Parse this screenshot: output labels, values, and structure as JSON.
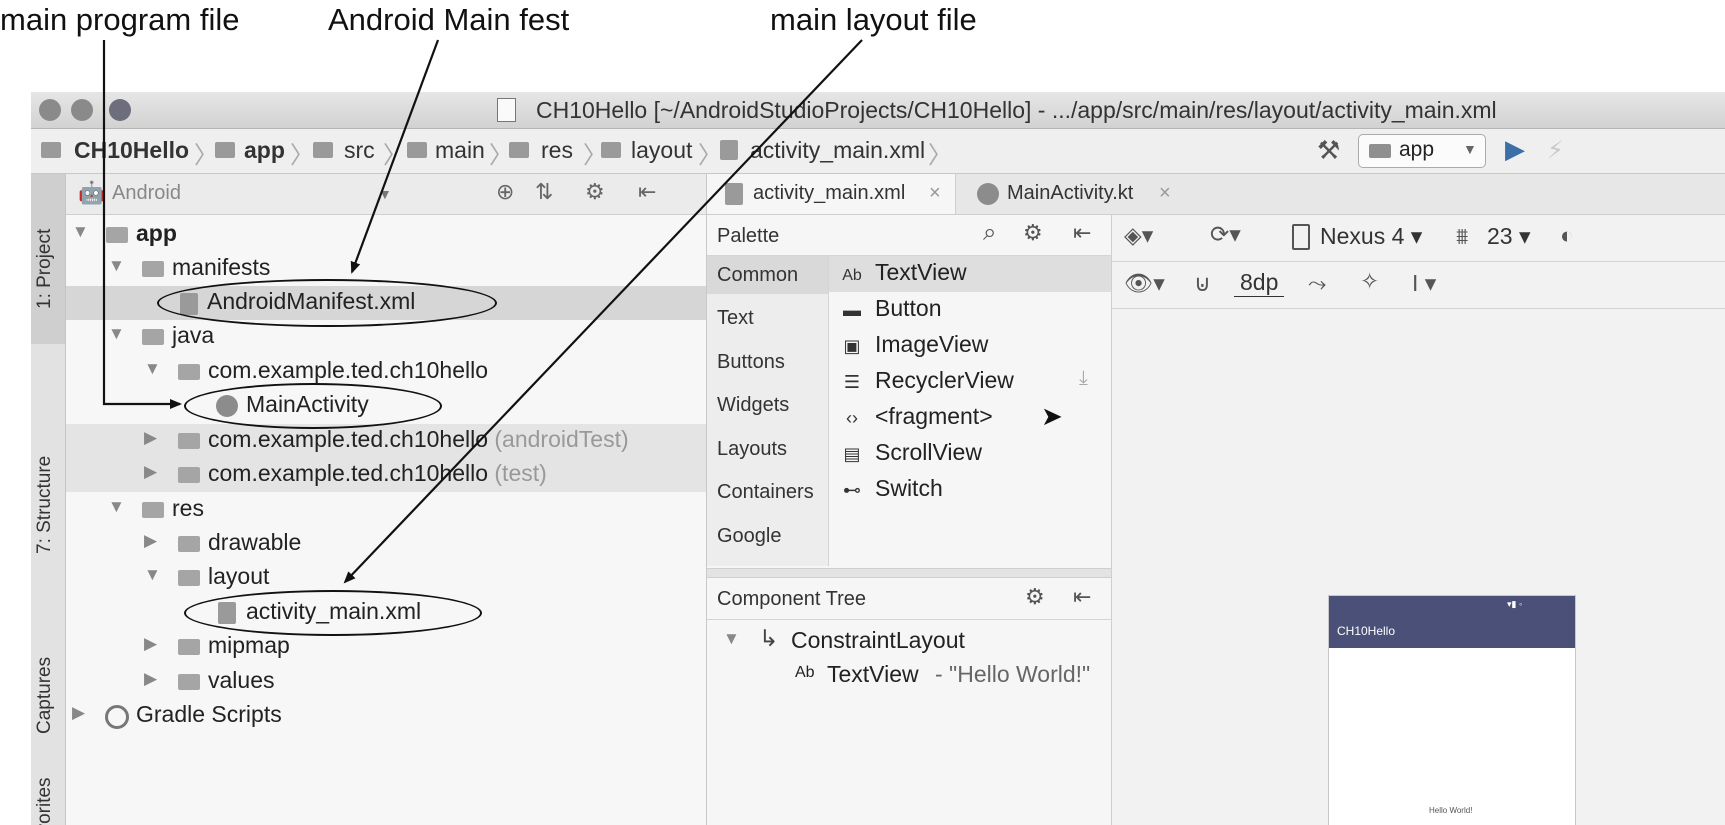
{
  "annotations": {
    "main_program": "main program file",
    "manifest": "Android Main fest",
    "layout": "main layout file"
  },
  "window": {
    "title": "CH10Hello [~/AndroidStudioProjects/CH10Hello] - .../app/src/main/res/layout/activity_main.xml"
  },
  "breadcrumb": [
    "CH10Hello",
    "app",
    "src",
    "main",
    "res",
    "layout",
    "activity_main.xml"
  ],
  "run_config": "app",
  "tool_strip": [
    "1: Project",
    "7: Structure",
    "Captures",
    "avorites"
  ],
  "project": {
    "view_mode": "Android",
    "rows": [
      {
        "label": "app"
      },
      {
        "label": "manifests"
      },
      {
        "label": "AndroidManifest.xml"
      },
      {
        "label": "java"
      },
      {
        "label": "com.example.ted.ch10hello"
      },
      {
        "label": "MainActivity"
      },
      {
        "label": "com.example.ted.ch10hello",
        "suffix": "(androidTest)"
      },
      {
        "label": "com.example.ted.ch10hello",
        "suffix": "(test)"
      },
      {
        "label": "res"
      },
      {
        "label": "drawable"
      },
      {
        "label": "layout"
      },
      {
        "label": "activity_main.xml"
      },
      {
        "label": "mipmap"
      },
      {
        "label": "values"
      },
      {
        "label": "Gradle Scripts"
      }
    ]
  },
  "editor_tabs": [
    "activity_main.xml",
    "MainActivity.kt"
  ],
  "palette": {
    "title": "Palette",
    "categories": [
      "Common",
      "Text",
      "Buttons",
      "Widgets",
      "Layouts",
      "Containers",
      "Google"
    ],
    "items": [
      "TextView",
      "Button",
      "ImageView",
      "RecyclerView",
      "<fragment>",
      "ScrollView",
      "Switch"
    ],
    "item_prefix_textview": "Ab"
  },
  "design_toolbar": {
    "device": "Nexus 4",
    "api": "23",
    "margin": "8dp"
  },
  "component_tree": {
    "title": "Component Tree",
    "root": "ConstraintLayout",
    "child": "TextView",
    "child_prefix": "Ab",
    "child_value": "- \"Hello World!\""
  },
  "preview": {
    "app_title": "CH10Hello",
    "body_text": "Hello World!"
  },
  "colors": {
    "app_bar": "#4a5078",
    "selection": "#d6d6d6"
  }
}
